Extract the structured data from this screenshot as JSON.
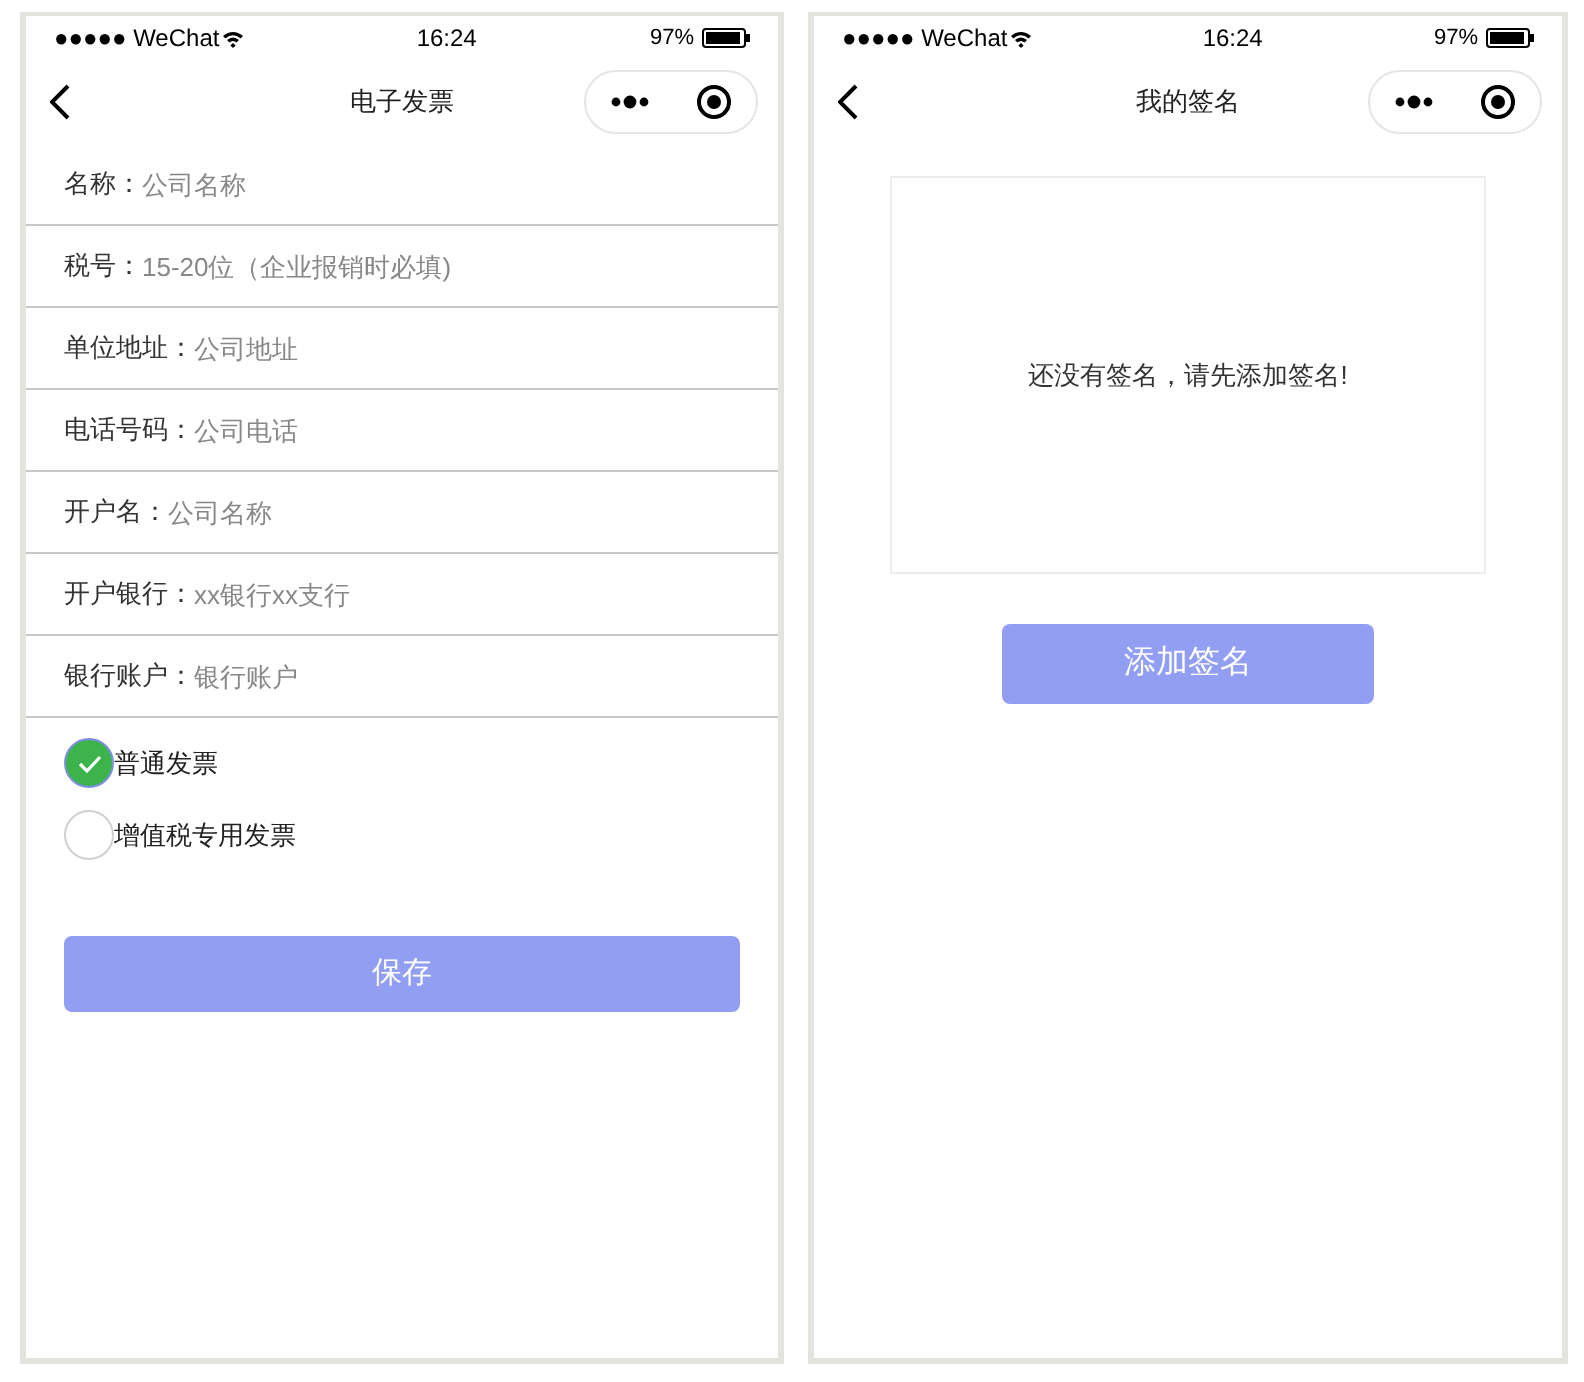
{
  "invoice_screen": {
    "status_bar": {
      "carrier": "●●●●● WeChat",
      "time": "16:24",
      "battery": "97%"
    },
    "title": "电子发票",
    "fields": [
      {
        "label": "名称：",
        "placeholder": "公司名称"
      },
      {
        "label": "税号：",
        "placeholder": "15-20位（企业报销时必填)"
      },
      {
        "label": "单位地址：",
        "placeholder": "公司地址"
      },
      {
        "label": "电话号码：",
        "placeholder": "公司电话"
      },
      {
        "label": "开户名：",
        "placeholder": "公司名称"
      },
      {
        "label": "开户银行：",
        "placeholder": "xx银行xx支行"
      },
      {
        "label": "银行账户：",
        "placeholder": "银行账户"
      }
    ],
    "invoice_types": [
      {
        "label": "普通发票",
        "selected": true
      },
      {
        "label": "增值税专用发票",
        "selected": false
      }
    ],
    "save_button": "保存"
  },
  "signature_screen": {
    "status_bar": {
      "carrier": "●●●●● WeChat",
      "time": "16:24",
      "battery": "97%"
    },
    "title": "我的签名",
    "empty_message": "还没有签名，请先添加签名!",
    "add_button": "添加签名"
  }
}
